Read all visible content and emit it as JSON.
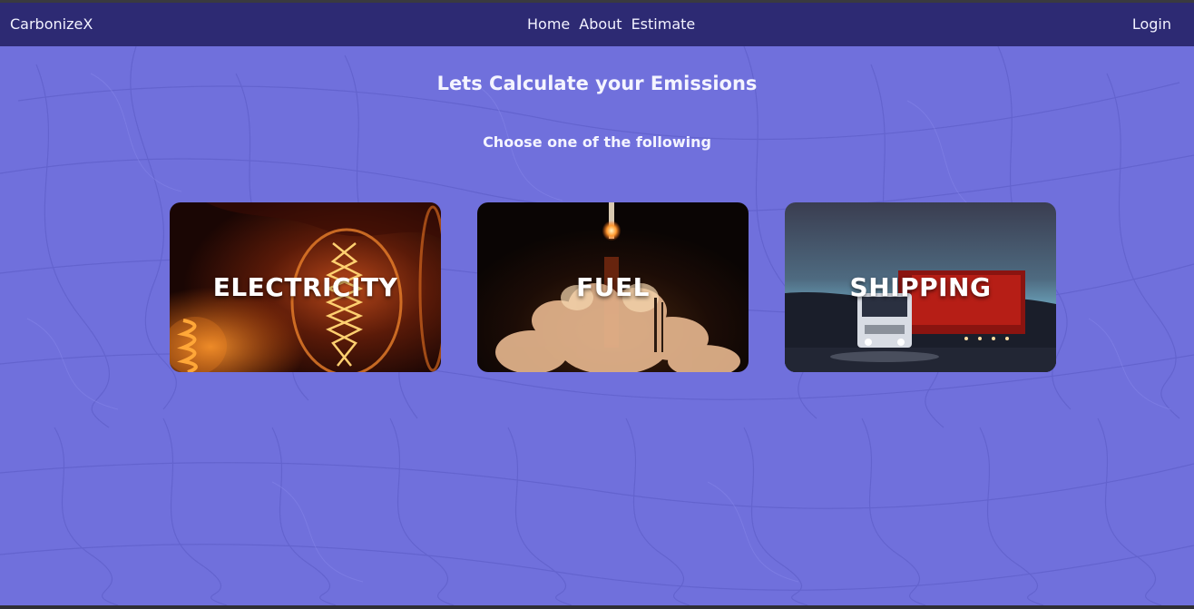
{
  "navbar": {
    "brand": "CarbonizeX",
    "links": [
      {
        "label": "Home"
      },
      {
        "label": "About"
      },
      {
        "label": "Estimate"
      }
    ],
    "login": "Login",
    "background": "#2d2a73"
  },
  "main": {
    "heading": "Lets Calculate your Emissions",
    "subheading": "Choose one of the following",
    "background": "#7070dc",
    "cards": [
      {
        "label": "ELECTRICITY",
        "image": "light-bulb-photo"
      },
      {
        "label": "FUEL",
        "image": "rocket-launch-photo"
      },
      {
        "label": "SHIPPING",
        "image": "truck-photo"
      }
    ]
  }
}
